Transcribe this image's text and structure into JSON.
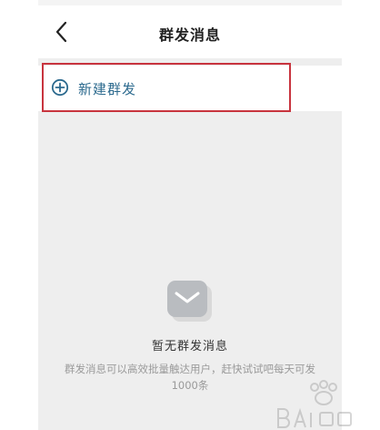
{
  "header": {
    "title": "群发消息",
    "back_icon": "chevron-left-icon"
  },
  "actions": {
    "new_broadcast_label": "新建群发",
    "new_broadcast_icon": "plus-circle-icon"
  },
  "empty_state": {
    "icon": "message-envelope-icon",
    "title": "暂无群发消息",
    "description": "群发消息可以高效批量触达用户，赶快试试吧每天可发1000条"
  },
  "colors": {
    "accent": "#2c6a8e",
    "highlight": "#c8343e",
    "background": "#eeeeee"
  }
}
